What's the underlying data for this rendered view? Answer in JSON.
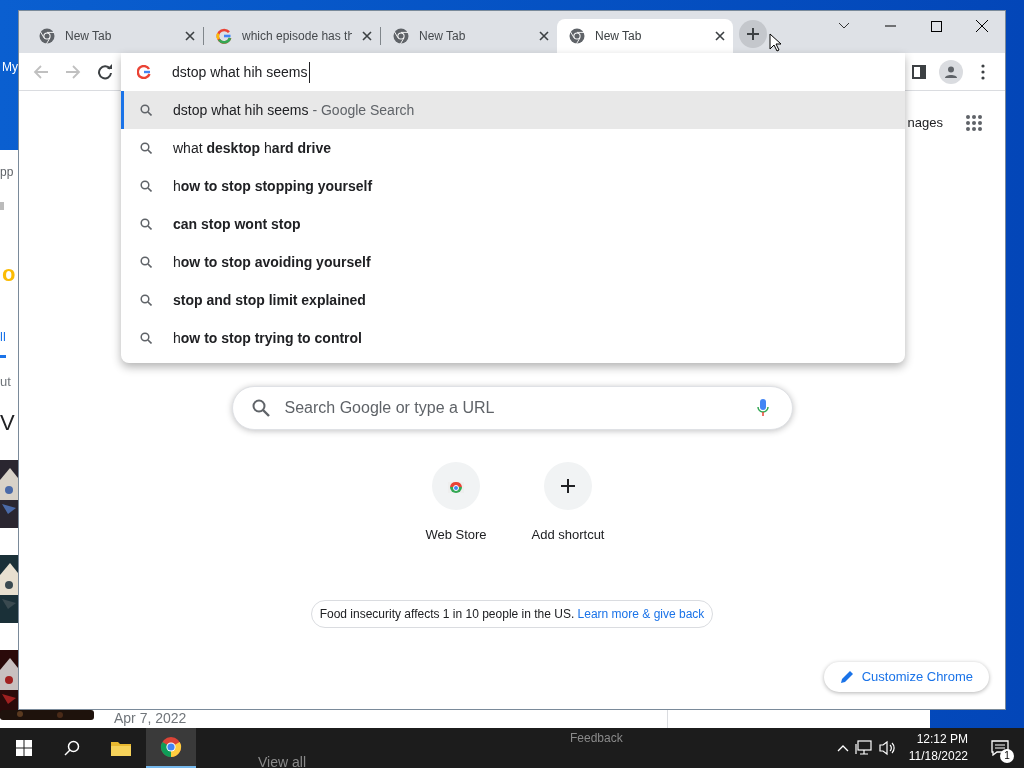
{
  "desktop": {
    "icon_label": "My"
  },
  "background_window": {
    "cut_texts": [
      "pp",
      "ll",
      "ut",
      "V"
    ],
    "logo_fragment": "o",
    "date": "Apr 7, 2022",
    "footer_link": "Feedback",
    "view_all": "View all"
  },
  "browser": {
    "tabs": [
      {
        "title": "New Tab",
        "kind": "chrome",
        "selected": false
      },
      {
        "title": "which episode has th",
        "kind": "google",
        "selected": false
      },
      {
        "title": "New Tab",
        "kind": "chrome",
        "selected": false
      },
      {
        "title": "New Tab",
        "kind": "chrome",
        "selected": true
      }
    ],
    "omnibox": {
      "value": "dstop what hih seems"
    },
    "suggestions": [
      {
        "text": "dstop what hih seems",
        "suffix": "- Google Search",
        "selected": true
      },
      {
        "text": "what **desktop** h**ard drive**",
        "selected": false
      },
      {
        "text": "h**ow to stop stopping yourself**",
        "selected": false
      },
      {
        "text": "**can stop wont stop**",
        "selected": false
      },
      {
        "text": "h**ow to stop avoiding yourself**",
        "selected": false
      },
      {
        "text": "**stop and stop limit explained**",
        "selected": false
      },
      {
        "text": "h**ow to stop trying to control**",
        "selected": false
      }
    ]
  },
  "new_tab_page": {
    "top_link": "nages",
    "search": {
      "placeholder": "Search Google or type a URL"
    },
    "shortcuts": [
      {
        "label": "Web Store",
        "kind": "webstore"
      },
      {
        "label": "Add shortcut",
        "kind": "add"
      }
    ],
    "promo": {
      "text": "Food insecurity affects 1 in 10 people in the US.",
      "link": "Learn more & give back"
    },
    "customize_button": "Customize Chrome"
  },
  "taskbar": {
    "apps": [
      {
        "kind": "explorer",
        "active": false
      },
      {
        "kind": "chrome",
        "active": true
      }
    ],
    "time": "12:12 PM",
    "date": "11/18/2022",
    "notification_count": "1"
  }
}
